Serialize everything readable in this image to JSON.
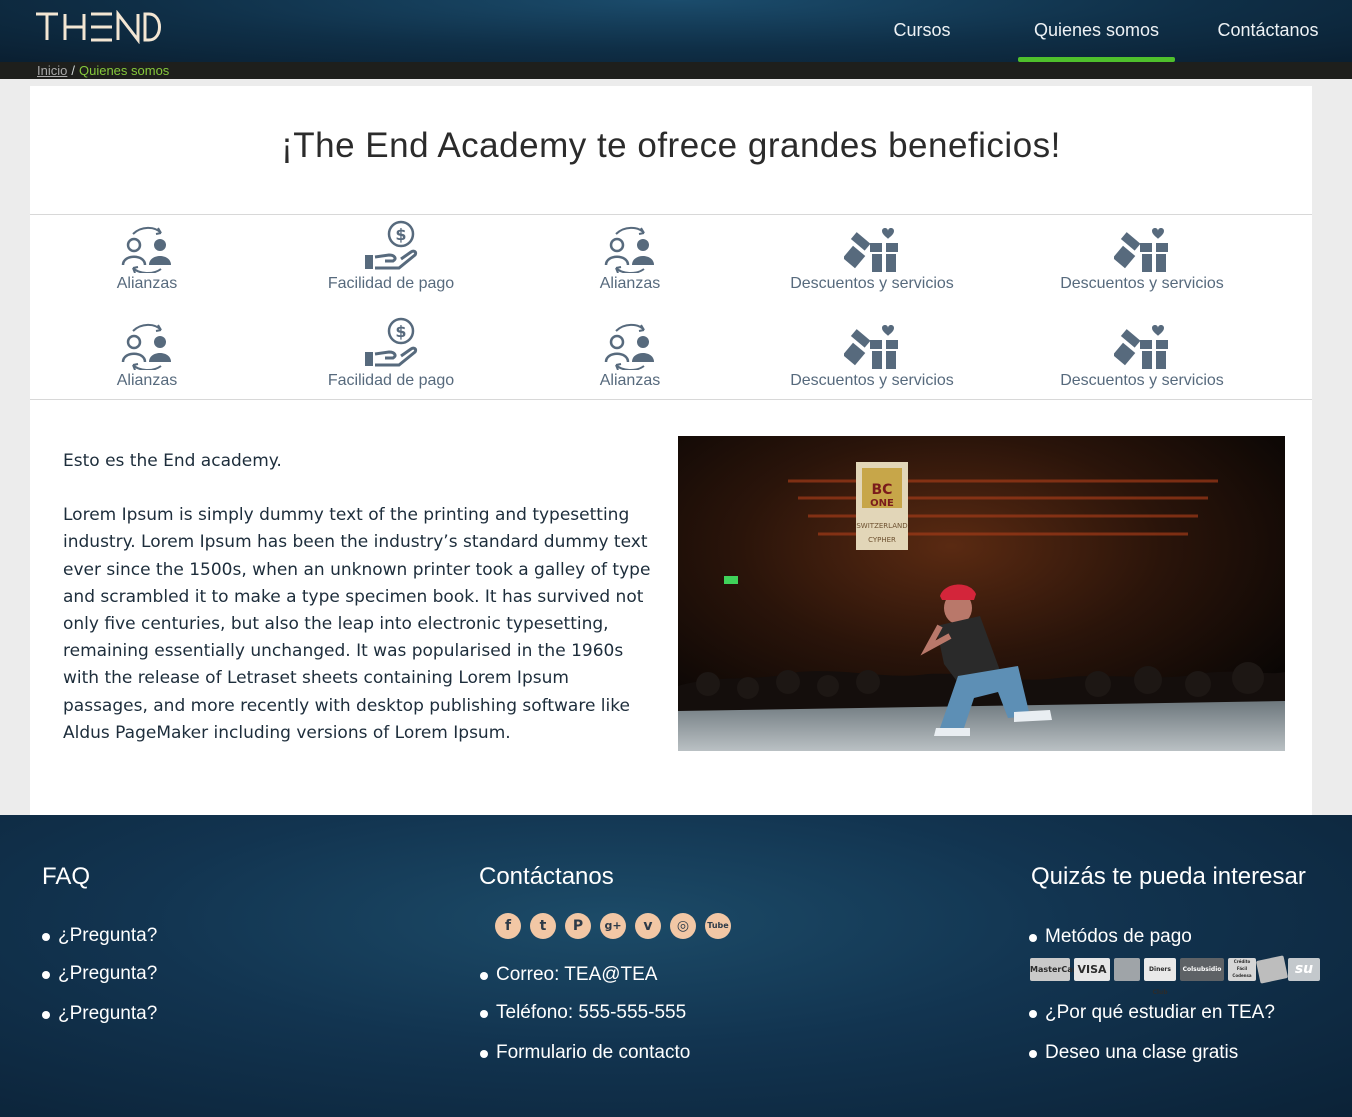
{
  "header": {
    "logo": "THEND",
    "nav": [
      "Cursos",
      "Quienes somos",
      "Contáctanos"
    ],
    "active_nav": "Quienes somos"
  },
  "breadcrumb": {
    "home": "Inicio",
    "separator": "/",
    "current": "Quienes somos"
  },
  "main": {
    "title": "¡The End Academy te ofrece grandes beneficios!",
    "benefits": [
      {
        "icon": "alliance-icon",
        "label": "Alianzas"
      },
      {
        "icon": "payment-hand-icon",
        "label": "Facilidad de pago"
      },
      {
        "icon": "alliance-icon",
        "label": "Alianzas"
      },
      {
        "icon": "gift-icon",
        "label": "Descuentos y servicios"
      },
      {
        "icon": "gift-icon",
        "label": "Descuentos y servicios"
      },
      {
        "icon": "alliance-icon",
        "label": "Alianzas"
      },
      {
        "icon": "payment-hand-icon",
        "label": "Facilidad de pago"
      },
      {
        "icon": "alliance-icon",
        "label": "Alianzas"
      },
      {
        "icon": "gift-icon",
        "label": "Descuentos y servicios"
      },
      {
        "icon": "gift-icon",
        "label": "Descuentos y servicios"
      }
    ],
    "intro": "Esto es the End academy.",
    "body": "Lorem Ipsum is simply dummy text of the printing and typesetting industry. Lorem Ipsum has been the industry’s standard dummy text ever since the 1500s, when an unknown printer took a galley of type and scrambled it to make a type specimen book. It has survived not only five centuries, but also the leap into electronic typesetting, remaining essentially unchanged. It was popularised in the 1960s with the release of Letraset sheets containing Lorem Ipsum passages, and more recently with desktop publishing software like Aldus PageMaker including versions of Lorem Ipsum.",
    "photo_sign": [
      "BC",
      "ONE",
      "SWITZERLAND",
      "CYPHER"
    ]
  },
  "footer": {
    "faq": {
      "title": "FAQ",
      "items": [
        "¿Pregunta?",
        "¿Pregunta?",
        "¿Pregunta?"
      ]
    },
    "contact": {
      "title": "Contáctanos",
      "social": [
        "facebook-icon",
        "twitter-icon",
        "pinterest-icon",
        "google-plus-icon",
        "vimeo-icon",
        "instagram-icon",
        "youtube-icon"
      ],
      "social_glyphs": [
        "f",
        "t",
        "P",
        "g+",
        "v",
        "◎",
        "Tube"
      ],
      "items": [
        "Correo: TEA@TEA",
        "Teléfono: 555-555-555",
        "Formulario de contacto"
      ]
    },
    "interest": {
      "title": "Quizás te pueda interesar",
      "items": [
        "Metódos de pago",
        "¿Por qué estudiar en TEA?",
        "Deseo una clase gratis"
      ],
      "payment_logos": [
        "MasterCard",
        "VISA",
        "",
        "Diners Club",
        "Colsubsidio",
        "Crédito Fácil Codensa",
        "",
        "su"
      ]
    }
  },
  "colors": {
    "accent_green": "#4fc02c",
    "breadcrumb_green": "#86c93c",
    "icon_slate": "#576a7d",
    "footer_blue": "#123450"
  }
}
